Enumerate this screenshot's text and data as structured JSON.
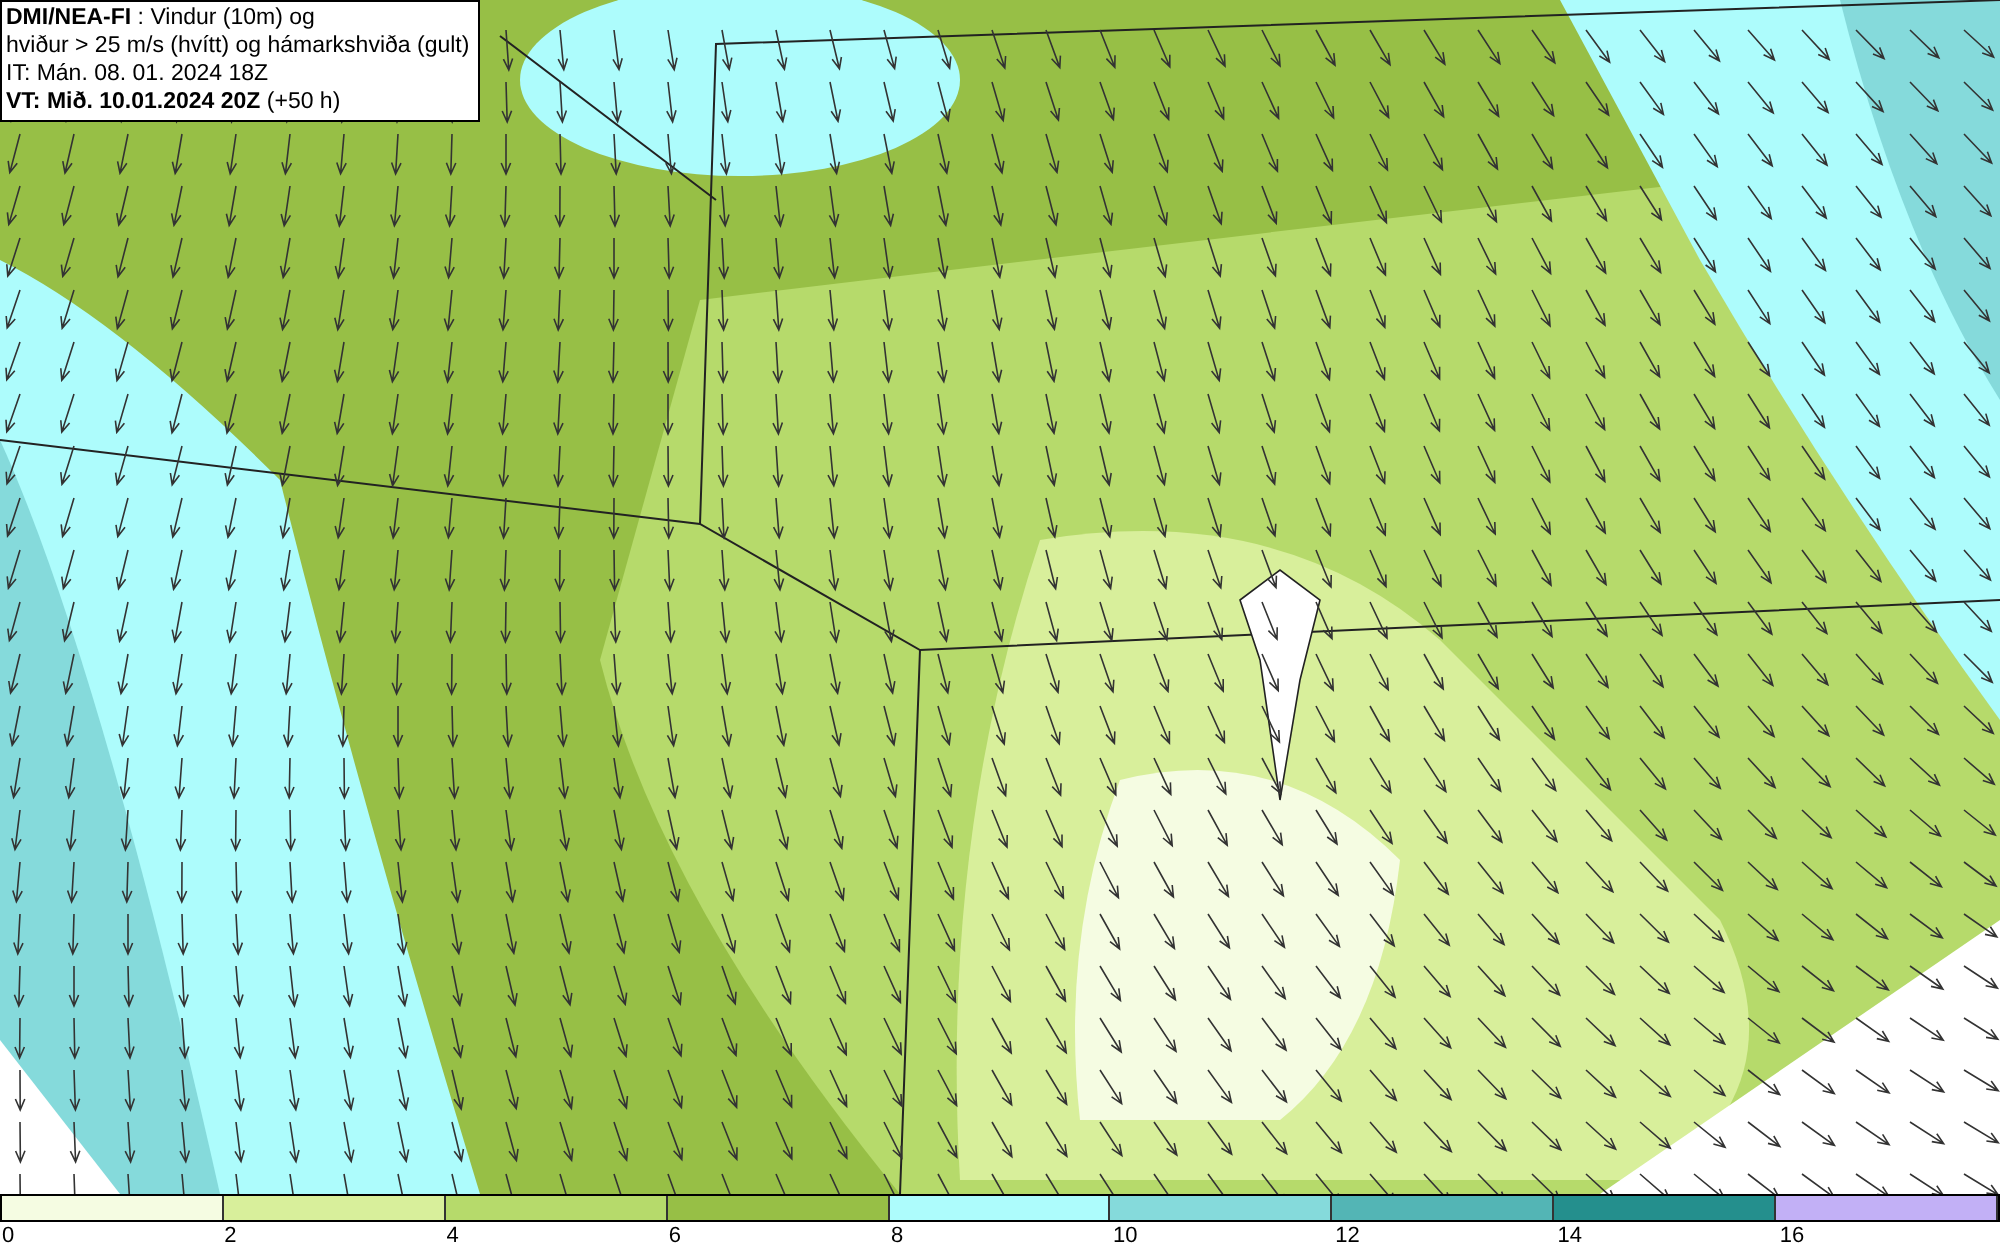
{
  "title_box": {
    "lines": [
      "**DMI/NEA-FI** : Vindur (10m) og",
      "hviður > 25 m/s (hvítt) og hámarkshviða (gult)",
      "IT: Mán. 08. 01. 2024 18Z",
      "**VT: Mið. 10.01.2024 20Z** (+50 h)"
    ]
  },
  "legend": {
    "bins": [
      {
        "color": "#f5fce2"
      },
      {
        "color": "#d8ef9b"
      },
      {
        "color": "#b6da6b"
      },
      {
        "color": "#97bf46"
      },
      {
        "color": "#adfcfc"
      },
      {
        "color": "#85dadb"
      },
      {
        "color": "#53b5b5"
      },
      {
        "color": "#248f8d"
      },
      {
        "color": "#c2b0f6"
      }
    ],
    "labels": [
      "0",
      "2",
      "4",
      "6",
      "8",
      "10",
      "12",
      "14",
      "16"
    ]
  }
}
